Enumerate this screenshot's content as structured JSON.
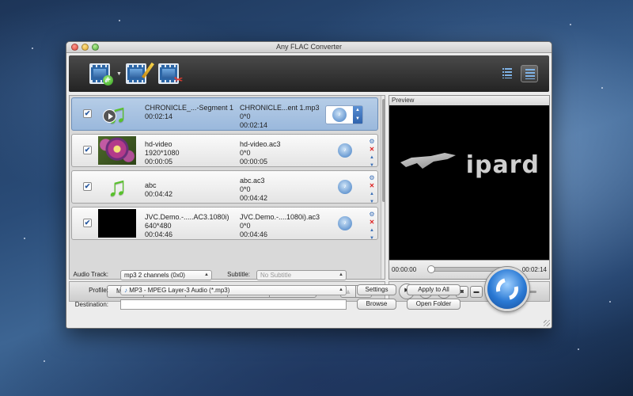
{
  "window": {
    "title": "Any FLAC Converter"
  },
  "files": [
    {
      "src_name": "CHRONICLE_...-Segment 1",
      "src_line2": "00:02:14",
      "src_line3": "",
      "dst_name": "CHRONICLE...ent 1.mp3",
      "dst_line2": "0*0",
      "dst_line3": "00:02:14",
      "thumb": "music-note-play-icon",
      "selected": true,
      "checked": true
    },
    {
      "src_name": "hd-video",
      "src_line2": "1920*1080",
      "src_line3": "00:00:05",
      "dst_name": "hd-video.ac3",
      "dst_line2": "0*0",
      "dst_line3": "00:00:05",
      "thumb": "flower-photo",
      "selected": false,
      "checked": true
    },
    {
      "src_name": "abc",
      "src_line2": "00:04:42",
      "src_line3": "",
      "dst_name": "abc.ac3",
      "dst_line2": "0*0",
      "dst_line3": "00:04:42",
      "thumb": "music-note-icon",
      "selected": false,
      "checked": true
    },
    {
      "src_name": "JVC.Demo.-.....AC3.1080i)",
      "src_line2": "640*480",
      "src_line3": "00:04:46",
      "dst_name": "JVC.Demo.-....1080i).ac3",
      "dst_line2": "0*0",
      "dst_line3": "00:04:46",
      "thumb": "black-video-frame",
      "selected": false,
      "checked": true
    }
  ],
  "list_toolbar": {
    "merge": "Merge",
    "rename": "Rename",
    "remove": "Remove",
    "clear_all": "Clear All",
    "properties": "Properties"
  },
  "preview": {
    "label": "Preview",
    "logo_text": "ipard",
    "time_start": "00:00:00",
    "time_end": "00:02:14",
    "seek_position": 0,
    "volume_level": 0.25
  },
  "settings": {
    "audio_track_label": "Audio Track:",
    "audio_track_value": "mp3 2 channels (0x0)",
    "subtitle_label": "Subtitle:",
    "subtitle_value": "No Subtitle",
    "profile_label": "Profile:",
    "profile_value": "MP3 - MPEG Layer-3 Audio (*.mp3)",
    "destination_label": "Destination:",
    "destination_value": "",
    "settings_button": "Settings",
    "apply_to_all_button": "Apply to All",
    "browse_button": "Browse",
    "open_folder_button": "Open Folder"
  },
  "colors": {
    "accent": "#2a79d4",
    "selected_row": "#a8c4e2",
    "toolbar_bg": "#2f2f2f"
  }
}
